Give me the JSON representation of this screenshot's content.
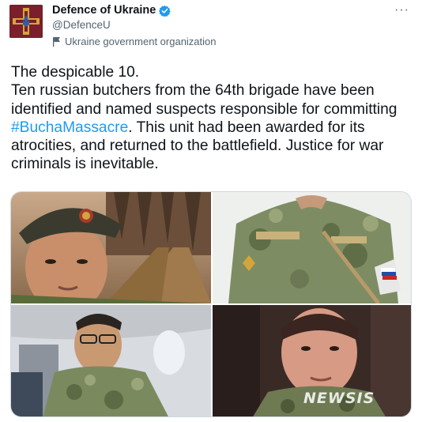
{
  "account": {
    "name": "Defence of Ukraine",
    "handle": "@DefenceU",
    "org_label": "Ukraine government organization",
    "verified_color": "#1d9bf0",
    "avatar_bg": "#7a1f2b"
  },
  "menu": {
    "more_label": "···"
  },
  "tweet": {
    "lines": [
      "The despicable 10.",
      "Ten russian butchers from the 64th brigade have been identified and named suspects responsible for committing "
    ],
    "hashtag": "#BuchaMassacre",
    "after_hashtag": ". This unit had been awarded for its atrocities, and returned to the battlefield. Justice for war criminals is inevitable.",
    "hashtag_color": "#1d9bf0"
  },
  "media": {
    "photos": [
      {
        "subject": "soldier-beret-forest"
      },
      {
        "subject": "camouflage-uniform-patches"
      },
      {
        "subject": "soldier-airplane-glasses"
      },
      {
        "subject": "soldier-closeup-dark"
      }
    ],
    "watermark": "NEWSIS"
  }
}
